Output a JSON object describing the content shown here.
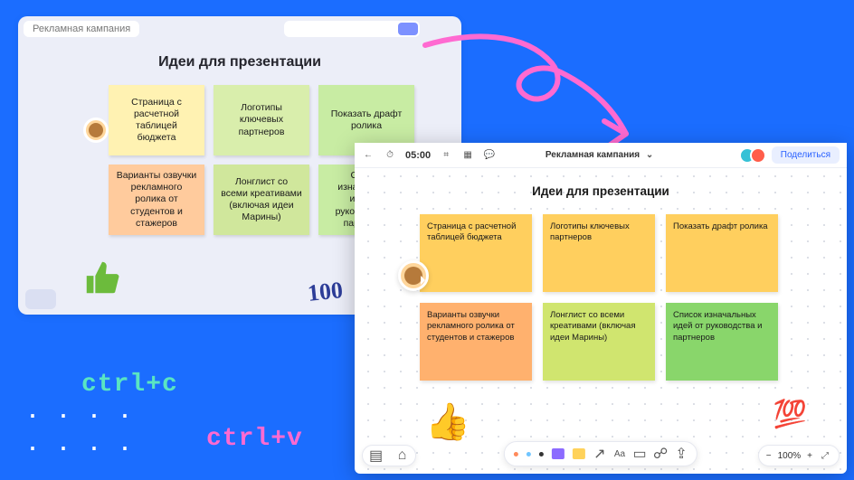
{
  "back_window": {
    "chip_label": "Рекламная кампания",
    "title": "Идеи для презентации",
    "notes": [
      "Страница с расчетной таблицей бюджета",
      "Логотипы ключевых партнеров",
      "Показать драфт ролика",
      "Варианты озвучки рекламного ролика от студентов и стажеров",
      "Лонглист со всеми креативами (включая идеи Марины)",
      "Список изначальных идей от руководства и партнеров"
    ],
    "sticker_100": "100"
  },
  "front_window": {
    "timer": "05:00",
    "breadcrumb": "Рекламная кампания",
    "share_label": "Поделиться",
    "title": "Идеи для презентации",
    "notes": [
      "Страница с расчетной таблицей бюджета",
      "Логотипы ключевых партнеров",
      "Показать драфт ролика",
      "Варианты озвучки рекламного ролика от студентов и стажеров",
      "Лонглист со всеми креативами (включая идеи Марины)",
      "Список изначальных идей от руководства и партнеров"
    ],
    "toolbar_text": "Aa",
    "zoom": {
      "minus": "−",
      "value": "100%",
      "plus": "+"
    },
    "thumb_emoji": "👍",
    "hundred_emoji": "💯"
  },
  "captions": {
    "copy": "ctrl+c",
    "paste": "ctrl+v"
  }
}
